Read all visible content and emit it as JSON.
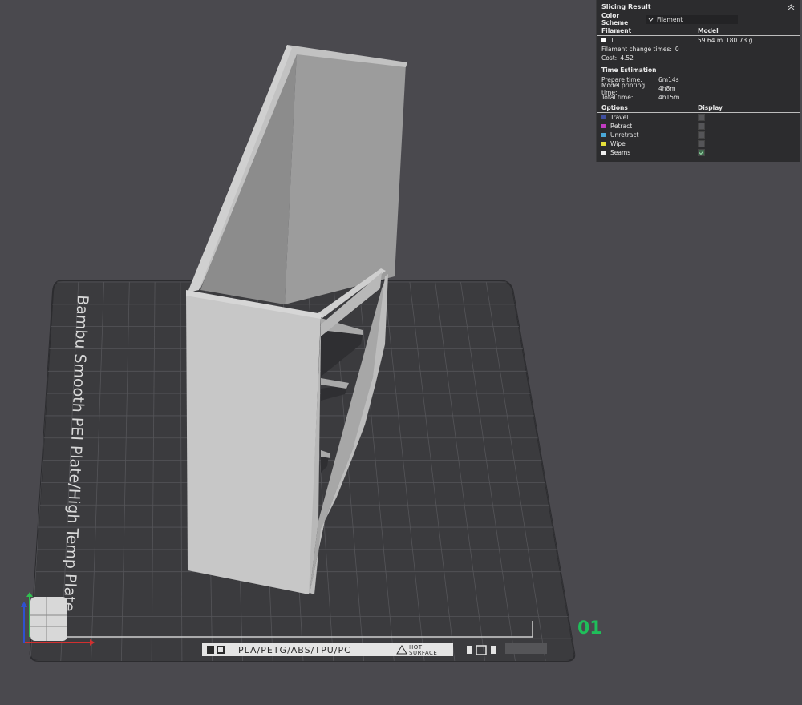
{
  "plate": {
    "name": "Bambu Smooth PEI Plate/High Temp Plate",
    "number": "01",
    "materials": "PLA/PETG/ABS/TPU/PC",
    "hot_surface_line1": "HOT",
    "hot_surface_line2": "SURFACE"
  },
  "panel": {
    "title": "Slicing Result",
    "color_scheme_label": "Color Scheme",
    "color_scheme_value": "Filament",
    "filament_header": "Filament",
    "model_header": "Model",
    "filament_index": "1",
    "filament_length": "59.64 m",
    "filament_weight": "180.73 g",
    "filament_color": "#ffffff",
    "change_times_label": "Filament change times:",
    "change_times_value": "0",
    "cost_label": "Cost:",
    "cost_value": "4.52",
    "time_header": "Time Estimation",
    "times": [
      {
        "label": "Prepare time:",
        "value": "6m14s"
      },
      {
        "label": "Model printing time:",
        "value": "4h8m"
      },
      {
        "label": "Total time:",
        "value": "4h15m"
      }
    ],
    "options_header": "Options",
    "display_header": "Display",
    "options": [
      {
        "label": "Travel",
        "color": "#3f4ea0",
        "checked": false
      },
      {
        "label": "Retract",
        "color": "#c23bc2",
        "checked": false
      },
      {
        "label": "Unretract",
        "color": "#4aa8d8",
        "checked": false
      },
      {
        "label": "Wipe",
        "color": "#e6e03a",
        "checked": false
      },
      {
        "label": "Seams",
        "color": "#eeeeee",
        "checked": true
      }
    ]
  }
}
